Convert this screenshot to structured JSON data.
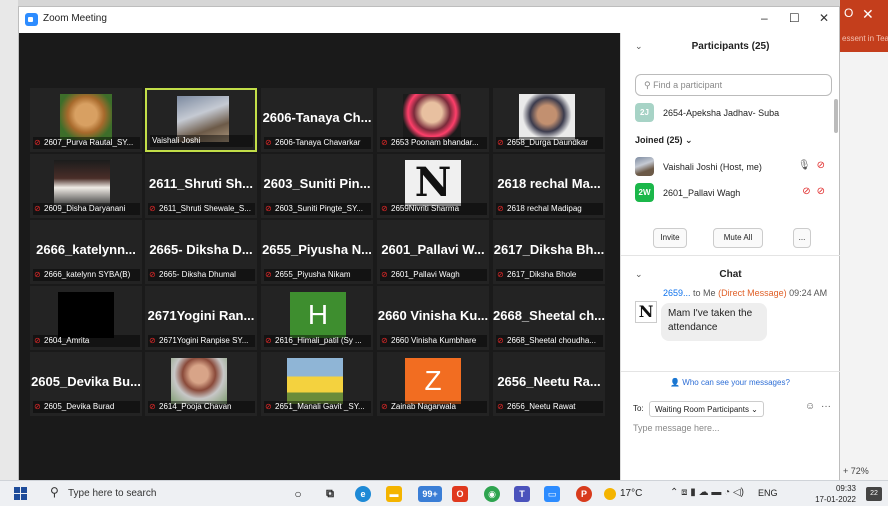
{
  "window": {
    "title": "Zoom Meeting",
    "minimize": "–",
    "maximize": "☐",
    "close": "✕"
  },
  "background": {
    "teams_hint": "essent in Tean",
    "zoom_pct": "+ 72%",
    "win_o": "O",
    "win_x": "✕"
  },
  "tiles": [
    {
      "big": "",
      "label": "2607_Purva Rautal_SY...",
      "muted": true
    },
    {
      "big": "",
      "label": "Vaishali Joshi",
      "muted": false
    },
    {
      "big": "2606-Tanaya Ch...",
      "label": "2606-Tanaya Chavarkar",
      "muted": true
    },
    {
      "big": "",
      "label": "2653 Poonam bhandar...",
      "muted": true
    },
    {
      "big": "",
      "label": "2658_Durga Daundkar",
      "muted": true
    },
    {
      "big": "",
      "label": "2609_Disha Daryanani",
      "muted": true
    },
    {
      "big": "2611_Shruti Sh...",
      "label": "2611_Shruti Shewale_S...",
      "muted": true
    },
    {
      "big": "2603_Suniti Pin...",
      "label": "2603_Suniti Pingte_SY...",
      "muted": true
    },
    {
      "big": "",
      "label": "2659Nivriti Sharma",
      "muted": true,
      "pic_text": "N"
    },
    {
      "big": "2618 rechal Ma...",
      "label": "2618 rechal Madipag",
      "muted": true
    },
    {
      "big": "2666_katelynn...",
      "label": "2666_katelynn SYBA(B)",
      "muted": true
    },
    {
      "big": "2665- Diksha D...",
      "label": "2665- Diksha Dhumal",
      "muted": true
    },
    {
      "big": "2655_Piyusha N...",
      "label": "2655_Piyusha Nikam",
      "muted": true
    },
    {
      "big": "2601_Pallavi W...",
      "label": "2601_Pallavi Wagh",
      "muted": true
    },
    {
      "big": "2617_Diksha Bh...",
      "label": "2617_Diksha Bhole",
      "muted": true
    },
    {
      "big": "",
      "label": "2604_Amrita",
      "muted": true
    },
    {
      "big": "2671Yogini Ran...",
      "label": "2671Yogini Ranpise SY...",
      "muted": true
    },
    {
      "big": "",
      "label": "2616_Himali_patil (Sy ...",
      "muted": true,
      "pic_text": "H"
    },
    {
      "big": "2660 Vinisha Ku...",
      "label": "2660 Vinisha Kumbhare",
      "muted": true
    },
    {
      "big": "2668_Sheetal ch...",
      "label": "2668_Sheetal choudha...",
      "muted": true
    },
    {
      "big": "2605_Devika Bu...",
      "label": "2605_Devika Burad",
      "muted": true
    },
    {
      "big": "",
      "label": "2614_Pooja Chavan",
      "muted": true
    },
    {
      "big": "",
      "label": "2651_Manali Gavit _SY...",
      "muted": true
    },
    {
      "big": "",
      "label": "Zainab Nagarwala",
      "muted": true,
      "pic_text": "Z"
    },
    {
      "big": "2656_Neetu Ra...",
      "label": "2656_Neetu Rawat",
      "muted": true
    }
  ],
  "participants": {
    "title": "Participants (25)",
    "chevron": "⌄",
    "find_placeholder": "Find a participant",
    "waiting": {
      "avatar": "2J",
      "name": "2654-Apeksha Jadhav- Suba"
    },
    "joined_label": "Joined (25)",
    "joined_chevron": "⌄",
    "joined": [
      {
        "name": "Vaishali Joshi (Host, me)"
      },
      {
        "avatar": "2W",
        "name": "2601_Pallavi Wagh"
      }
    ],
    "invite": "Invite",
    "mute_all": "Mute All",
    "more": "..."
  },
  "chat": {
    "title": "Chat",
    "chevron": "⌄",
    "sender": "2659...",
    "to": "to Me",
    "dm": "(Direct Message)",
    "time": "09:24 AM",
    "avatar": "N",
    "message": "Mam I've taken the attendance",
    "who_see": "Who can see your messages?",
    "to_label": "To:",
    "to_value": "Waiting Room Participants ⌄",
    "placeholder": "Type message here..."
  },
  "taskbar": {
    "search_placeholder": "Type here to search",
    "badge": "99+",
    "temp": "17°C",
    "lang": "ENG",
    "time": "09:33",
    "date": "17-01-2022",
    "notif": "22"
  },
  "colors": {
    "accent": "#2d8cff",
    "active_speaker": "#c2de48",
    "muted": "#e02828",
    "video_bg": "#1a1a1a"
  }
}
